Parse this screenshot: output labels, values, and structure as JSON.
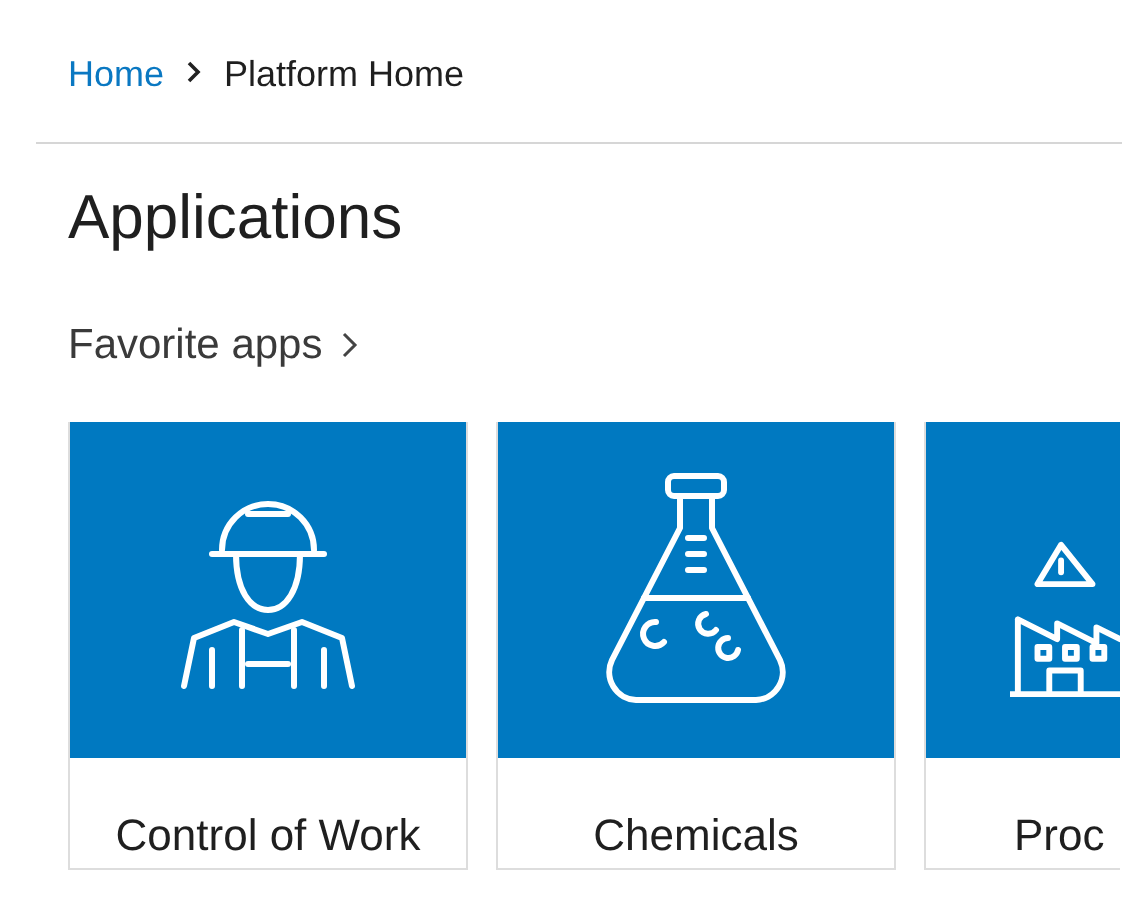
{
  "breadcrumb": [
    {
      "label": "Home",
      "kind": "link"
    },
    {
      "label": "Platform Home",
      "kind": "current"
    }
  ],
  "page_title": "Applications",
  "section": {
    "title": "Favorite apps"
  },
  "apps": [
    {
      "title": "Control of Work",
      "kind": "worker"
    },
    {
      "title": "Chemicals",
      "kind": "flask"
    },
    {
      "title": "Proc",
      "kind": "factory"
    }
  ]
}
